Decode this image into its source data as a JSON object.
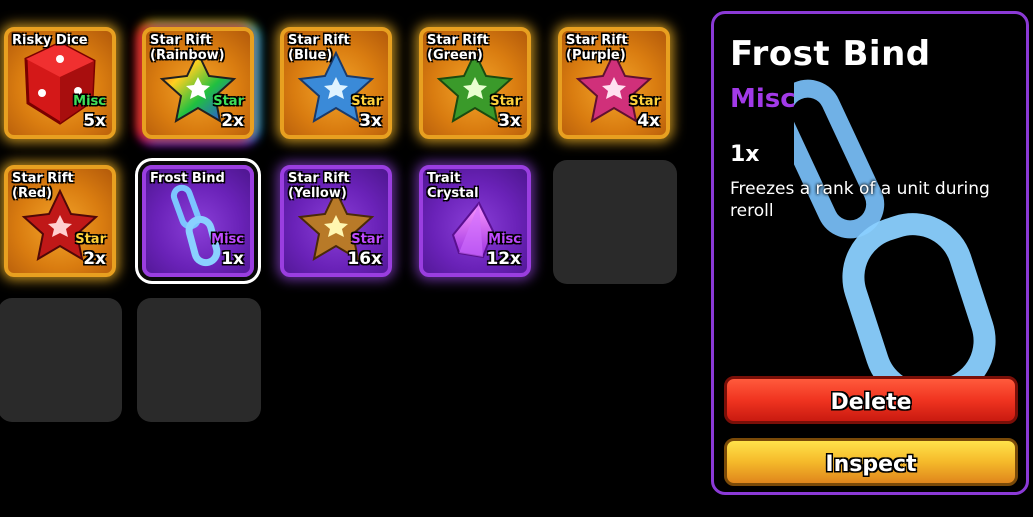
{
  "inventory": {
    "slots": [
      {
        "name": "Risky Dice",
        "rarity": "Misc",
        "rarity_color": "#3ee05a",
        "count": "5x"
      },
      {
        "name": "Star Rift\n(Rainbow)",
        "rarity": "Star",
        "rarity_color": "#3ee05a",
        "count": "2x"
      },
      {
        "name": "Star Rift\n(Blue)",
        "rarity": "Star",
        "rarity_color": "#ffd23a",
        "count": "3x"
      },
      {
        "name": "Star Rift\n(Green)",
        "rarity": "Star",
        "rarity_color": "#ffd23a",
        "count": "3x"
      },
      {
        "name": "Star Rift\n(Purple)",
        "rarity": "Star",
        "rarity_color": "#ffd23a",
        "count": "4x"
      },
      {
        "name": "Star Rift\n(Red)",
        "rarity": "Star",
        "rarity_color": "#ffd23a",
        "count": "2x"
      },
      {
        "name": "Frost Bind",
        "rarity": "Misc",
        "rarity_color": "#c04bff",
        "count": "1x"
      },
      {
        "name": "Star Rift\n(Yellow)",
        "rarity": "Star",
        "rarity_color": "#c04bff",
        "count": "16x"
      },
      {
        "name": "Trait\nCrystal",
        "rarity": "Misc",
        "rarity_color": "#c04bff",
        "count": "12x"
      }
    ]
  },
  "detail": {
    "title": "Frost Bind",
    "rarity": "Misc",
    "rarity_color": "#a23ae8",
    "quantity": "1x",
    "description": "Freezes a rank of a unit during reroll",
    "delete_label": "Delete",
    "inspect_label": "Inspect"
  },
  "icons": {
    "risky_dice": "red-dice-icon",
    "star_rift": "star-icon",
    "frost_bind": "ice-chain-icon",
    "trait_crystal": "crystal-icon"
  }
}
